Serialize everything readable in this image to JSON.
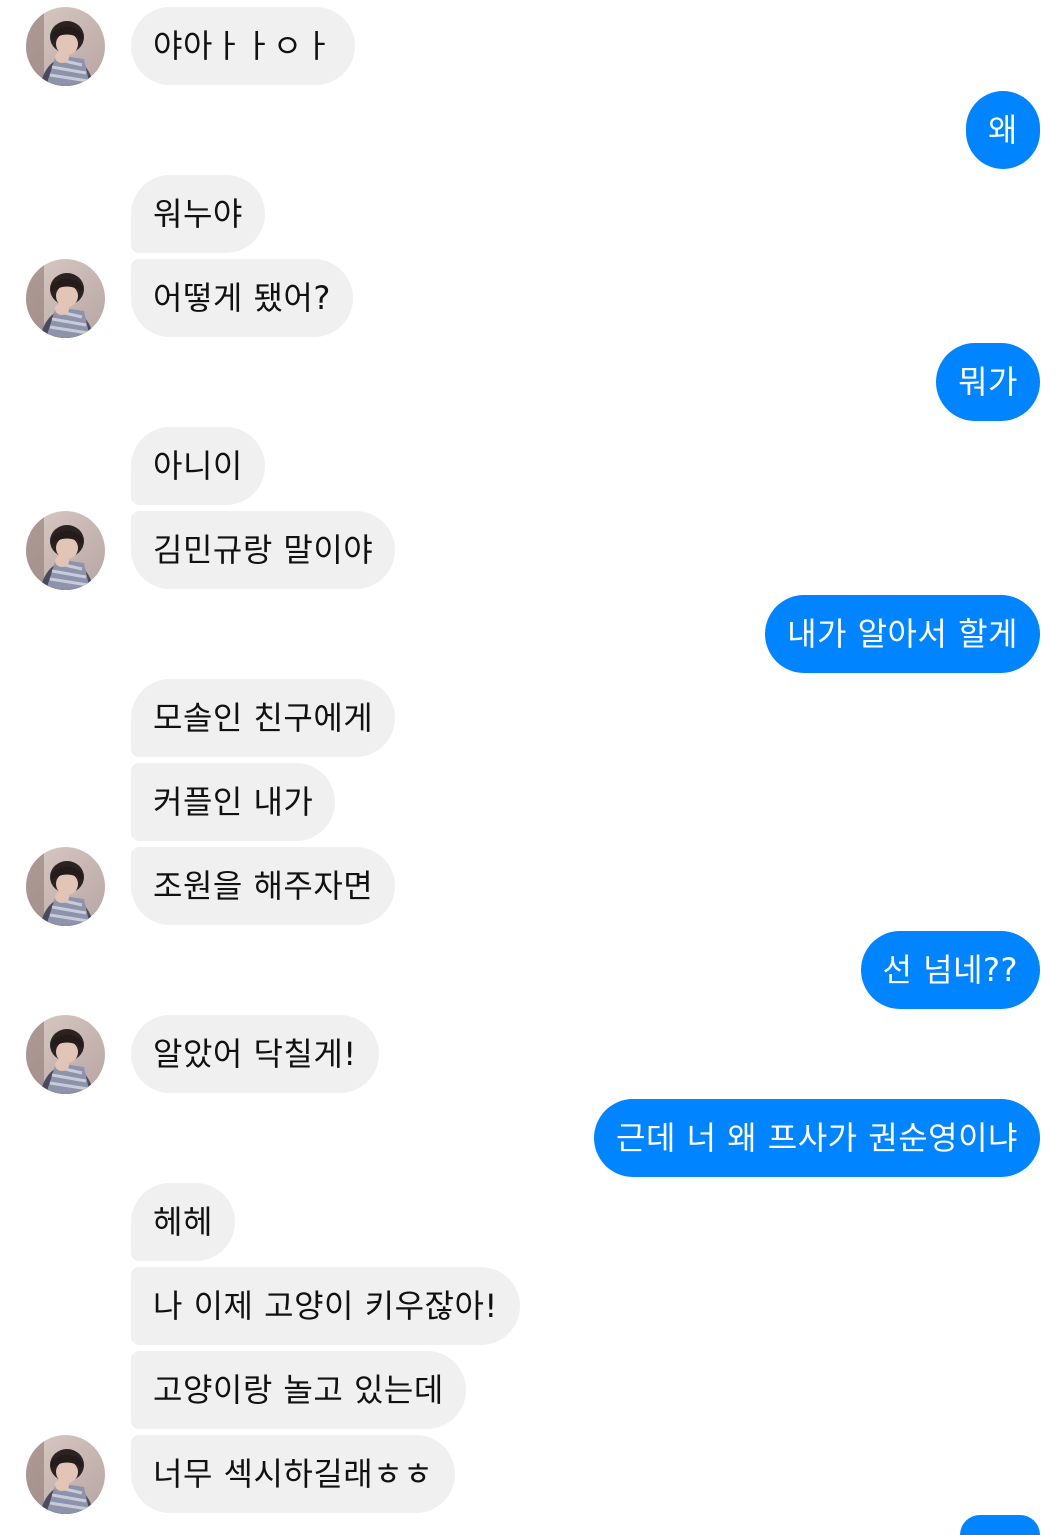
{
  "conversation": {
    "messages": [
      {
        "side": "in",
        "text": "야아ㅏㅏㅇㅏ"
      },
      {
        "side": "out",
        "text": "왜"
      },
      {
        "side": "in",
        "text": "워누야"
      },
      {
        "side": "in",
        "text": "어떻게 됐어?"
      },
      {
        "side": "out",
        "text": "뭐가"
      },
      {
        "side": "in",
        "text": "아니이"
      },
      {
        "side": "in",
        "text": "김민규랑 말이야"
      },
      {
        "side": "out",
        "text": "내가 알아서 할게"
      },
      {
        "side": "in",
        "text": "모솔인 친구에게"
      },
      {
        "side": "in",
        "text": "커플인 내가"
      },
      {
        "side": "in",
        "text": "조원을 해주자면"
      },
      {
        "side": "out",
        "text": "선 넘네??"
      },
      {
        "side": "in",
        "text": "알았어 닥칠게!"
      },
      {
        "side": "out",
        "text": "근데 너 왜 프사가 권순영이냐"
      },
      {
        "side": "in",
        "text": "헤헤"
      },
      {
        "side": "in",
        "text": "나 이제 고양이 키우잖아!"
      },
      {
        "side": "in",
        "text": "고양이랑 놀고 있는데"
      },
      {
        "side": "in",
        "text": "너무 섹시하길래ㅎㅎ"
      }
    ]
  },
  "colors": {
    "incoming_bubble": "#f1f0f0",
    "outgoing_bubble": "#0084ff",
    "incoming_text": "#111111",
    "outgoing_text": "#ffffff"
  },
  "icons": {
    "avatar": "profile-photo"
  }
}
